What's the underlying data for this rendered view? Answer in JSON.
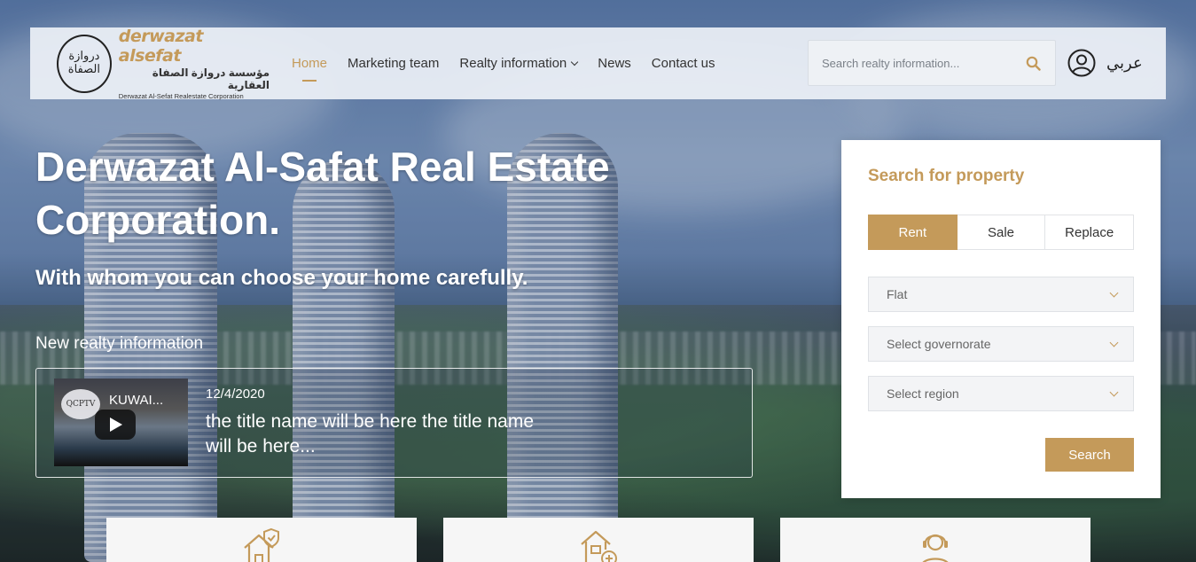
{
  "header": {
    "logo": {
      "brand_en": "derwazat alsefat",
      "brand_ar": "مؤسسة دروازة الصفاة العقارية",
      "subtitle": "Derwazat Al-Sefat Realestate Corporation",
      "emblem_text": "دروازة الصفاة"
    },
    "nav": [
      {
        "label": "Home",
        "active": true
      },
      {
        "label": "Marketing team",
        "active": false
      },
      {
        "label": "Realty information",
        "active": false,
        "has_dropdown": true
      },
      {
        "label": "News",
        "active": false
      },
      {
        "label": "Contact us",
        "active": false
      }
    ],
    "search": {
      "placeholder": "Search realty information..."
    },
    "user_icon": "user-circle-icon",
    "language_label": "عربي"
  },
  "hero": {
    "title": "Derwazat Al-Safat Real Estate Corporation.",
    "subtitle": "With whom you can choose your home carefully.",
    "new_info_label": "New realty information",
    "news_item": {
      "video_channel": "QCPTV",
      "video_title": "KUWAI...",
      "date": "12/4/2020",
      "title": "the title name will be here the title name will be here..."
    }
  },
  "property_search": {
    "title": "Search for property",
    "tabs": [
      {
        "label": "Rent",
        "active": true
      },
      {
        "label": "Sale",
        "active": false
      },
      {
        "label": "Replace",
        "active": false
      }
    ],
    "selects": [
      {
        "value": "Flat"
      },
      {
        "value": "Select governorate"
      },
      {
        "value": "Select region"
      }
    ],
    "submit_label": "Search"
  },
  "feature_cards": [
    {
      "icon": "house-shield-icon"
    },
    {
      "icon": "house-add-icon"
    },
    {
      "icon": "support-agent-icon"
    }
  ],
  "colors": {
    "accent": "#c49a5a",
    "header_bg": "#ecf0f6",
    "panel_bg": "#ffffff",
    "text_dark": "#333333"
  }
}
